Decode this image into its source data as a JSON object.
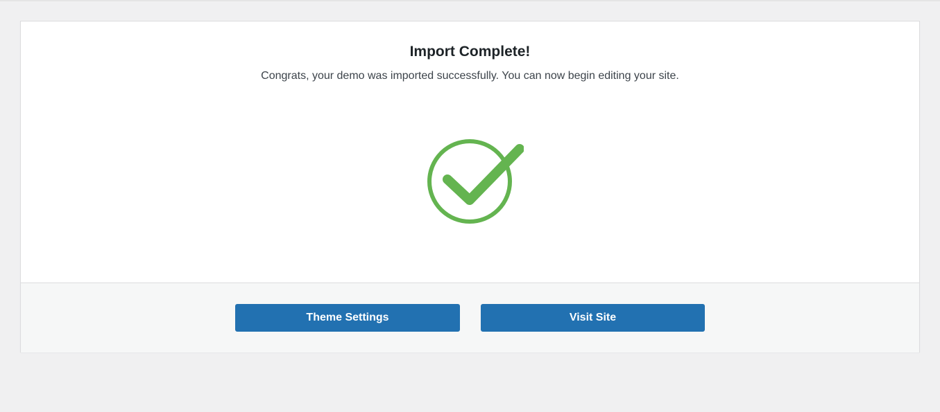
{
  "dialog": {
    "title": "Import Complete!",
    "message": "Congrats, your demo was imported successfully. You can now begin editing your site.",
    "status_icon": "check-circle-icon",
    "status_color": "#64b450"
  },
  "actions": {
    "theme_settings_label": "Theme Settings",
    "visit_site_label": "Visit Site",
    "button_color": "#2271b1"
  }
}
